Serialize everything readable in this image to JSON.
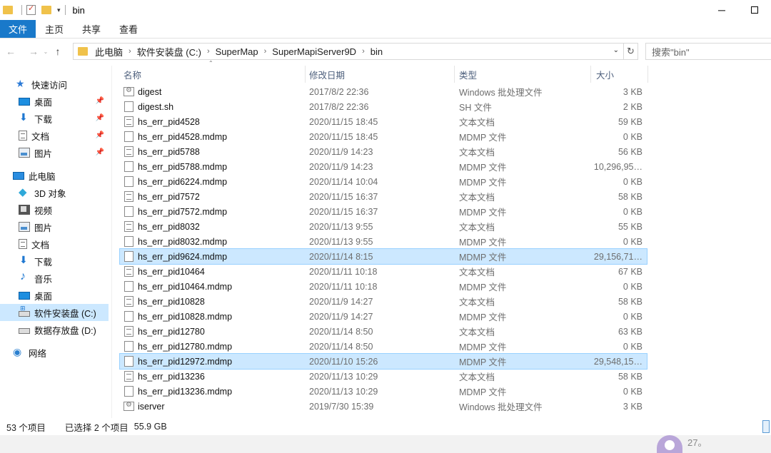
{
  "window": {
    "title": "bin",
    "minimize_icon": "─",
    "quick_access_dropdown": "▾"
  },
  "ribbon": {
    "tabs": [
      "文件",
      "主页",
      "共享",
      "查看"
    ]
  },
  "nav_buttons": {
    "back": "←",
    "forward": "→",
    "recent": "⌄",
    "up": "↑"
  },
  "address": {
    "crumbs": [
      "此电脑",
      "软件安装盘 (C:)",
      "SuperMap",
      "SuperMapiServer9D",
      "bin"
    ],
    "chevron": "›",
    "dropdown": "⌄",
    "refresh": "↻"
  },
  "search": {
    "placeholder": "搜索\"bin\""
  },
  "nav_pane": {
    "pin_icon": "📌",
    "items": [
      {
        "label": "快速访问",
        "icon": "star-icon"
      },
      {
        "label": "桌面",
        "icon": "desktop-icon",
        "pinned": true
      },
      {
        "label": "下载",
        "icon": "download-icon",
        "pinned": true
      },
      {
        "label": "文档",
        "icon": "document-icon",
        "pinned": true
      },
      {
        "label": "图片",
        "icon": "picture-icon",
        "pinned": true
      },
      {
        "label": "此电脑",
        "icon": "computer-icon"
      },
      {
        "label": "3D 对象",
        "icon": "3d-objects-icon"
      },
      {
        "label": "视频",
        "icon": "video-icon"
      },
      {
        "label": "图片",
        "icon": "picture-icon"
      },
      {
        "label": "文档",
        "icon": "document-icon"
      },
      {
        "label": "下载",
        "icon": "download-icon"
      },
      {
        "label": "音乐",
        "icon": "music-icon"
      },
      {
        "label": "桌面",
        "icon": "desktop-icon"
      },
      {
        "label": "软件安装盘 (C:)",
        "icon": "drive-c-icon",
        "selected": true
      },
      {
        "label": "数据存放盘 (D:)",
        "icon": "drive-icon"
      },
      {
        "label": "网络",
        "icon": "network-icon"
      }
    ]
  },
  "columns": {
    "name": "名称",
    "date": "修改日期",
    "type": "类型",
    "size": "大小",
    "sort_indicator": "⌃"
  },
  "files": [
    {
      "name": "digest",
      "date": "2017/8/2 22:36",
      "type": "Windows 批处理文件",
      "size": "3 KB",
      "icon": "batch-file-icon"
    },
    {
      "name": "digest.sh",
      "date": "2017/8/2 22:36",
      "type": "SH 文件",
      "size": "2 KB",
      "icon": "file-icon"
    },
    {
      "name": "hs_err_pid4528",
      "date": "2020/11/15 18:45",
      "type": "文本文档",
      "size": "59 KB",
      "icon": "text-file-icon"
    },
    {
      "name": "hs_err_pid4528.mdmp",
      "date": "2020/11/15 18:45",
      "type": "MDMP 文件",
      "size": "0 KB",
      "icon": "file-icon"
    },
    {
      "name": "hs_err_pid5788",
      "date": "2020/11/9 14:23",
      "type": "文本文档",
      "size": "56 KB",
      "icon": "text-file-icon"
    },
    {
      "name": "hs_err_pid5788.mdmp",
      "date": "2020/11/9 14:23",
      "type": "MDMP 文件",
      "size": "10,296,95…",
      "icon": "file-icon"
    },
    {
      "name": "hs_err_pid6224.mdmp",
      "date": "2020/11/14 10:04",
      "type": "MDMP 文件",
      "size": "0 KB",
      "icon": "file-icon"
    },
    {
      "name": "hs_err_pid7572",
      "date": "2020/11/15 16:37",
      "type": "文本文档",
      "size": "58 KB",
      "icon": "text-file-icon"
    },
    {
      "name": "hs_err_pid7572.mdmp",
      "date": "2020/11/15 16:37",
      "type": "MDMP 文件",
      "size": "0 KB",
      "icon": "file-icon"
    },
    {
      "name": "hs_err_pid8032",
      "date": "2020/11/13 9:55",
      "type": "文本文档",
      "size": "55 KB",
      "icon": "text-file-icon"
    },
    {
      "name": "hs_err_pid8032.mdmp",
      "date": "2020/11/13 9:55",
      "type": "MDMP 文件",
      "size": "0 KB",
      "icon": "file-icon"
    },
    {
      "name": "hs_err_pid9624.mdmp",
      "date": "2020/11/14 8:15",
      "type": "MDMP 文件",
      "size": "29,156,71…",
      "icon": "file-icon",
      "selected": true
    },
    {
      "name": "hs_err_pid10464",
      "date": "2020/11/11 10:18",
      "type": "文本文档",
      "size": "67 KB",
      "icon": "text-file-icon"
    },
    {
      "name": "hs_err_pid10464.mdmp",
      "date": "2020/11/11 10:18",
      "type": "MDMP 文件",
      "size": "0 KB",
      "icon": "file-icon"
    },
    {
      "name": "hs_err_pid10828",
      "date": "2020/11/9 14:27",
      "type": "文本文档",
      "size": "58 KB",
      "icon": "text-file-icon"
    },
    {
      "name": "hs_err_pid10828.mdmp",
      "date": "2020/11/9 14:27",
      "type": "MDMP 文件",
      "size": "0 KB",
      "icon": "file-icon"
    },
    {
      "name": "hs_err_pid12780",
      "date": "2020/11/14 8:50",
      "type": "文本文档",
      "size": "63 KB",
      "icon": "text-file-icon"
    },
    {
      "name": "hs_err_pid12780.mdmp",
      "date": "2020/11/14 8:50",
      "type": "MDMP 文件",
      "size": "0 KB",
      "icon": "file-icon"
    },
    {
      "name": "hs_err_pid12972.mdmp",
      "date": "2020/11/10 15:26",
      "type": "MDMP 文件",
      "size": "29,548,15…",
      "icon": "file-icon",
      "selected": true
    },
    {
      "name": "hs_err_pid13236",
      "date": "2020/11/13 10:29",
      "type": "文本文档",
      "size": "58 KB",
      "icon": "text-file-icon"
    },
    {
      "name": "hs_err_pid13236.mdmp",
      "date": "2020/11/13 10:29",
      "type": "MDMP 文件",
      "size": "0 KB",
      "icon": "file-icon"
    },
    {
      "name": "iserver",
      "date": "2019/7/30 15:39",
      "type": "Windows 批处理文件",
      "size": "3 KB",
      "icon": "batch-file-icon"
    }
  ],
  "status": {
    "count": "53 个项目",
    "selected": "已选择 2 个项目",
    "size": "55.9 GB"
  },
  "overlay": {
    "badge": "27。"
  }
}
